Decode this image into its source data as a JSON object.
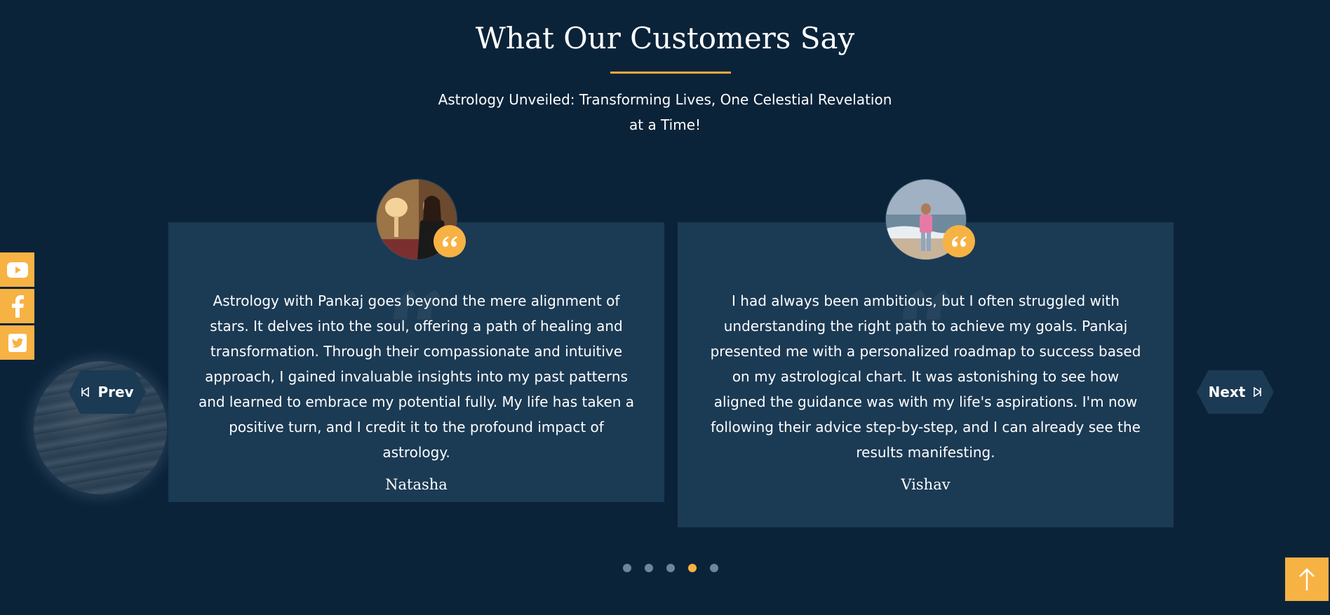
{
  "section": {
    "title": "What Our Customers Say",
    "subtitle": "Astrology Unveiled: Transforming Lives, One Celestial Revelation at a Time!"
  },
  "colors": {
    "background": "#0b2339",
    "card": "#1b3a54",
    "accent": "#f7b244",
    "dot_inactive": "#6f8599"
  },
  "navigation": {
    "prev_label": "Prev",
    "next_label": "Next"
  },
  "social": [
    "youtube-icon",
    "facebook-icon",
    "twitter-icon"
  ],
  "testimonials": [
    {
      "review": "Astrology with Pankaj goes beyond the mere alignment of stars. It delves into the soul, offering a path of healing and transformation. Through their compassionate and intuitive approach, I gained invaluable insights into my past patterns and learned to embrace my potential fully. My life has taken a positive turn, and I credit it to the profound impact of astrology.",
      "author": "Natasha"
    },
    {
      "review": "I had always been ambitious, but I often struggled with understanding the right path to achieve my goals. Pankaj presented me with a personalized roadmap to success based on my astrological chart. It was astonishing to see how aligned the guidance was with my life's aspirations. I'm now following their advice step-by-step, and I can already see the results manifesting.",
      "author": "Vishav"
    }
  ],
  "pagination": {
    "total": 5,
    "active_index": 3
  }
}
